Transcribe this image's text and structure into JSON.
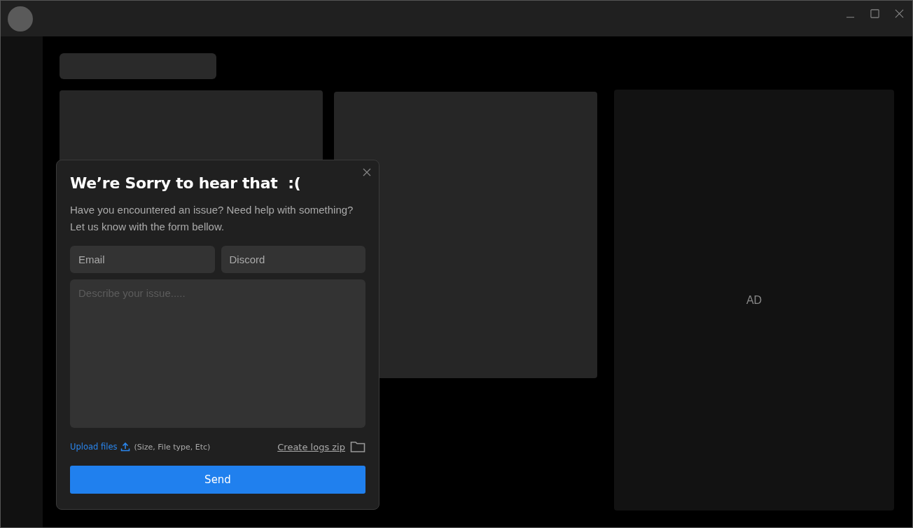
{
  "ad": {
    "label": "AD"
  },
  "dialog": {
    "title": "We’re Sorry to hear that  :(",
    "description": "Have you encountered an issue? Need help with something? Let us know with the form bellow.",
    "fields": [
      {
        "placeholder": "Email"
      },
      {
        "placeholder": "Discord"
      }
    ],
    "issue": {
      "placeholder": "Describe your issue....."
    },
    "upload": {
      "label": "Upload files",
      "hint": "(Size, File type, Etc)"
    },
    "logs": {
      "label": "Create logs zip"
    },
    "send": {
      "label": "Send"
    }
  }
}
